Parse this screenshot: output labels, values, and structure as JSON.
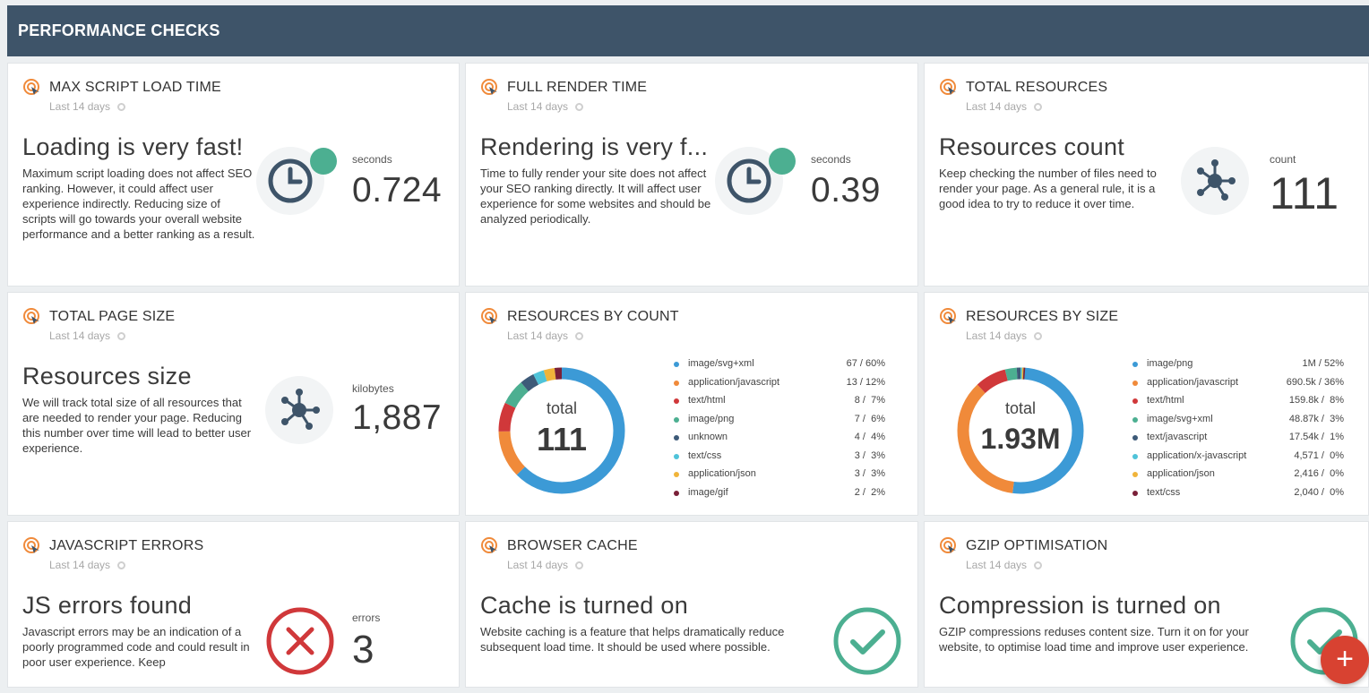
{
  "header": {
    "title": "PERFORMANCE CHECKS"
  },
  "cards": {
    "max_script": {
      "title": "MAX SCRIPT LOAD TIME",
      "subtitle": "Last 14 days",
      "headline": "Loading is very fast!",
      "description": "Maximum script loading does not affect SEO ranking. However, it could affect user experience indirectly. Reducing size of scripts will go towards your overall website performance and a better ranking as a result.",
      "metric_label": "seconds",
      "metric_value": "0.724",
      "icon": "clock-icon",
      "status_color": "#4caf91"
    },
    "full_render": {
      "title": "FULL RENDER TIME",
      "subtitle": "Last 14 days",
      "headline": "Rendering is very f...",
      "description": "Time to fully render your site does not affect your SEO ranking directly. It will affect user experience for some websites and should be analyzed periodically.",
      "metric_label": "seconds",
      "metric_value": "0.39",
      "icon": "clock-icon",
      "status_color": "#4caf91"
    },
    "total_resources": {
      "title": "TOTAL RESOURCES",
      "subtitle": "Last 14 days",
      "headline": "Resources count",
      "description": "Keep checking the number of files need to render your page. As a general rule, it is a good idea to try to reduce it over time.",
      "metric_label": "count",
      "metric_value": "111",
      "icon": "network-icon"
    },
    "total_page_size": {
      "title": "TOTAL PAGE SIZE",
      "subtitle": "Last 14 days",
      "headline": "Resources size",
      "description": "We will track total size of all resources that are needed to render your page. Reducing this number over time will lead to better user experience.",
      "metric_label": "kilobytes",
      "metric_value": "1,887",
      "icon": "network-icon"
    },
    "resources_by_count": {
      "title": "RESOURCES BY COUNT",
      "subtitle": "Last 14 days",
      "center_label": "total",
      "center_value": "111"
    },
    "resources_by_size": {
      "title": "RESOURCES BY SIZE",
      "subtitle": "Last 14 days",
      "center_label": "total",
      "center_value": "1.93M"
    },
    "js_errors": {
      "title": "JAVASCRIPT ERRORS",
      "subtitle": "Last 14 days",
      "headline": "JS errors found",
      "description": "Javascript errors may be an indication of a poorly programmed code and could result in poor user experience. Keep",
      "metric_label": "errors",
      "metric_value": "3",
      "icon": "error-x-icon",
      "status_color": "#d0383a"
    },
    "browser_cache": {
      "title": "BROWSER CACHE",
      "subtitle": "Last 14 days",
      "headline": "Cache is turned on",
      "description": "Website caching is a feature that helps dramatically reduce subsequent load time. It should be used where possible.",
      "icon": "checkmark-icon",
      "status_color": "#4caf91"
    },
    "gzip": {
      "title": "GZIP OPTIMISATION",
      "subtitle": "Last 14 days",
      "headline": "Compression is turned on",
      "description": "GZIP compressions reduses content size. Turn it on for your website, to optimise load time and improve user experience.",
      "icon": "checkmark-icon",
      "status_color": "#4caf91"
    }
  },
  "fab": {
    "label": "+"
  },
  "chart_data": [
    {
      "type": "pie",
      "title": "RESOURCES BY COUNT",
      "center_label": "total",
      "center_value": "111",
      "categories": [
        "image/svg+xml",
        "application/javascript",
        "text/html",
        "image/png",
        "unknown",
        "text/css",
        "application/json",
        "image/gif"
      ],
      "values": [
        67,
        13,
        8,
        7,
        4,
        3,
        3,
        2
      ],
      "value_labels": [
        "67 / 60%",
        "13 / 12%",
        "8 /  7%",
        "7 /  6%",
        "4 /  4%",
        "3 /  3%",
        "3 /  3%",
        "2 /  2%"
      ],
      "percents": [
        60,
        12,
        7,
        6,
        4,
        3,
        3,
        2
      ],
      "colors": [
        "#3c9ad6",
        "#f08a3a",
        "#d0383a",
        "#4caf91",
        "#3d5a78",
        "#4fc3d9",
        "#f0b43a",
        "#7a2038"
      ],
      "legend": "right"
    },
    {
      "type": "pie",
      "title": "RESOURCES BY SIZE",
      "center_label": "total",
      "center_value": "1.93M",
      "categories": [
        "image/png",
        "application/javascript",
        "text/html",
        "image/svg+xml",
        "text/javascript",
        "application/x-javascript",
        "application/json",
        "text/css"
      ],
      "value_labels": [
        "1M / 52%",
        "690.5k / 36%",
        "159.8k /  8%",
        "48.87k /  3%",
        "17.54k /  1%",
        "4,571 /  0%",
        "2,416 /  0%",
        "2,040 /  0%"
      ],
      "percents": [
        52,
        36,
        8,
        3,
        1,
        0,
        0,
        0
      ],
      "colors": [
        "#3c9ad6",
        "#f08a3a",
        "#d0383a",
        "#4caf91",
        "#3d5a78",
        "#4fc3d9",
        "#f0b43a",
        "#7a2038"
      ],
      "legend": "right"
    }
  ]
}
